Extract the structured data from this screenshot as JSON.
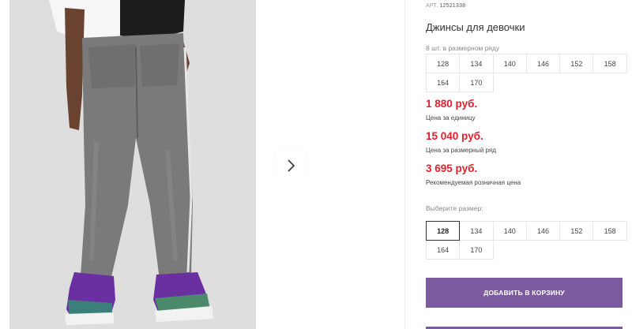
{
  "gallery": {
    "next_icon": "chevron-right-icon"
  },
  "product": {
    "article_label": "АРТ.",
    "article_number": "12521338",
    "title": "Джинсы для девочки",
    "pack_caption": "8 шт. в размерном ряду",
    "pack_sizes": [
      "128",
      "134",
      "140",
      "146",
      "152",
      "158",
      "164",
      "170"
    ],
    "prices": {
      "unit_price": "1 880 руб.",
      "unit_label": "Цена за единицу",
      "row_price": "15 040 руб.",
      "row_label": "Цена за размерный ряд",
      "retail_price": "3 695 руб.",
      "retail_label": "Рекомендуемая розничная цена"
    },
    "select_caption": "Выберите размер:",
    "select_sizes": [
      "128",
      "134",
      "140",
      "146",
      "152",
      "158",
      "164",
      "170"
    ],
    "selected_size": "128",
    "add_to_cart_label": "ДОБАВИТЬ В КОРЗИНУ"
  },
  "colors": {
    "price_red": "#e31e2d",
    "button_purple": "#7c5aa0"
  }
}
